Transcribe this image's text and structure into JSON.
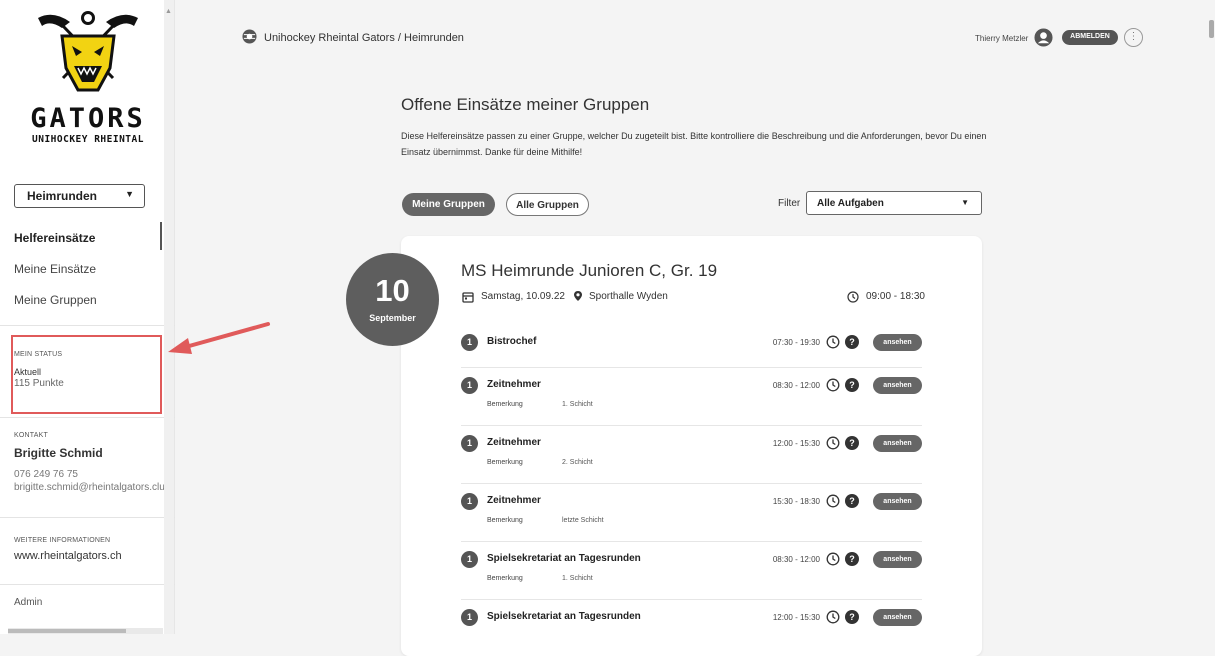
{
  "sidebar": {
    "logo": {
      "title": "GATORS",
      "subtitle": "UNIHOCKEY RHEINTAL"
    },
    "select": {
      "value": "Heimrunden"
    },
    "nav": [
      {
        "label": "Helfereinsätze",
        "active": true
      },
      {
        "label": "Meine Einsätze",
        "active": false
      },
      {
        "label": "Meine Gruppen",
        "active": false
      }
    ],
    "status": {
      "label": "MEIN STATUS",
      "sub": "Aktuell",
      "points": "115 Punkte"
    },
    "contact": {
      "label": "KONTAKT",
      "name": "Brigitte Schmid",
      "phone": "076 249 76 75",
      "email": "brigitte.schmid@rheintalgators.clu"
    },
    "more": {
      "label": "WEITERE INFORMATIONEN",
      "link": "www.rheintalgators.ch"
    },
    "admin": "Admin"
  },
  "header": {
    "breadcrumb": "Unihockey Rheintal Gators / Heimrunden",
    "user_name": "Thierry Metzler",
    "logout_label": "ABMELDEN",
    "more_icon": "⋮"
  },
  "main": {
    "title": "Offene Einsätze meiner Gruppen",
    "description": "Diese Helfereinsätze passen zu einer Gruppe, welcher Du zugeteilt bist. Bitte kontrolliere die Beschreibung und die Anforderungen, bevor Du einen Einsatz übernimmst. Danke für deine Mithilfe!",
    "tabs": [
      {
        "label": "Meine Gruppen",
        "active": true
      },
      {
        "label": "Alle Gruppen",
        "active": false
      }
    ],
    "filter": {
      "label": "Filter",
      "value": "Alle Aufgaben"
    }
  },
  "event": {
    "day": "10",
    "month": "September",
    "title": "MS Heimrunde Junioren C, Gr. 19",
    "date": "Samstag, 10.09.22",
    "location": "Sporthalle Wyden",
    "time": "09:00 - 18:30",
    "tasks": [
      {
        "count": "1",
        "name": "Bistrochef",
        "time": "07:30 - 19:30",
        "remark_label": "",
        "remark": "",
        "button": "ansehen"
      },
      {
        "count": "1",
        "name": "Zeitnehmer",
        "time": "08:30 - 12:00",
        "remark_label": "Bemerkung",
        "remark": "1. Schicht",
        "button": "ansehen"
      },
      {
        "count": "1",
        "name": "Zeitnehmer",
        "time": "12:00 - 15:30",
        "remark_label": "Bemerkung",
        "remark": "2. Schicht",
        "button": "ansehen"
      },
      {
        "count": "1",
        "name": "Zeitnehmer",
        "time": "15:30 - 18:30",
        "remark_label": "Bemerkung",
        "remark": "letzte Schicht",
        "button": "ansehen"
      },
      {
        "count": "1",
        "name": "Spielsekretariat an Tagesrunden",
        "time": "08:30 - 12:00",
        "remark_label": "Bemerkung",
        "remark": "1. Schicht",
        "button": "ansehen"
      },
      {
        "count": "1",
        "name": "Spielsekretariat an Tagesrunden",
        "time": "12:00 - 15:30",
        "remark_label": "",
        "remark": "",
        "button": "ansehen"
      }
    ]
  },
  "colors": {
    "accent": "#5e5e5e",
    "highlight": "#e05a5a",
    "logo_yellow": "#f2d312"
  }
}
